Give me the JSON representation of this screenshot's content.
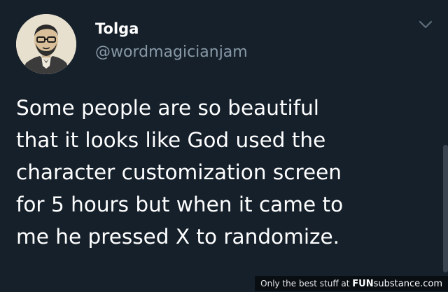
{
  "user": {
    "display_name": "Tolga",
    "handle": "@wordmagicianjam",
    "avatar_icon": "profile-avatar-illustration"
  },
  "tweet": {
    "lines": [
      "Some people are so beautiful",
      "that it looks like God used the",
      "character customization screen",
      "for 5 hours but when it came to",
      "me he pressed X to randomize."
    ]
  },
  "menu": {
    "icon": "chevron-down-icon"
  },
  "watermark": {
    "prefix": "Only the best stuff at ",
    "brand_bold": "FUN",
    "brand_rest": "substance.com"
  },
  "colors": {
    "background": "#15202b",
    "text": "#ffffff",
    "secondary_text": "#8899a6"
  }
}
